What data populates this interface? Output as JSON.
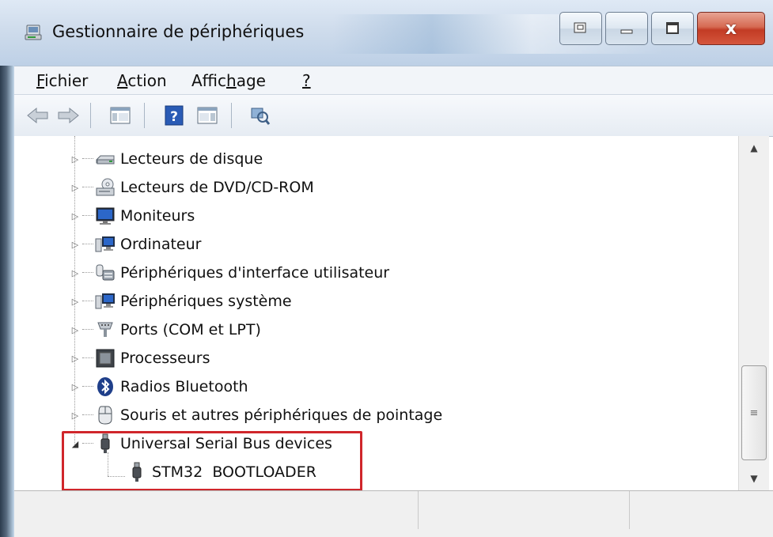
{
  "window": {
    "title": "Gestionnaire de périphériques",
    "buttons": {
      "extra": "",
      "minimize": "",
      "maximize": "",
      "close": "x"
    }
  },
  "menu": [
    {
      "label": "Fichier",
      "mnemonic": "F"
    },
    {
      "label": "Action",
      "mnemonic": "A"
    },
    {
      "label": "Affichage",
      "mnemonic": "h"
    },
    {
      "label": "?",
      "mnemonic": "?"
    }
  ],
  "toolbar": [
    "back-icon",
    "forward-icon",
    "show-hide-console-tree-icon",
    "help-icon",
    "show-action-pane-icon",
    "scan-hardware-icon"
  ],
  "tree": [
    {
      "label": "Lecteurs de disque",
      "icon": "disk-drive-icon",
      "expanded": false
    },
    {
      "label": "Lecteurs de DVD/CD-ROM",
      "icon": "dvd-drive-icon",
      "expanded": false
    },
    {
      "label": "Moniteurs",
      "icon": "monitor-icon",
      "expanded": false
    },
    {
      "label": "Ordinateur",
      "icon": "computer-icon",
      "expanded": false
    },
    {
      "label": "Périphériques d'interface utilisateur",
      "icon": "hid-icon",
      "expanded": false
    },
    {
      "label": "Périphériques système",
      "icon": "system-devices-icon",
      "expanded": false
    },
    {
      "label": "Ports (COM et LPT)",
      "icon": "ports-icon",
      "expanded": false
    },
    {
      "label": "Processeurs",
      "icon": "processor-icon",
      "expanded": false
    },
    {
      "label": "Radios Bluetooth",
      "icon": "bluetooth-icon",
      "expanded": false
    },
    {
      "label": "Souris et autres périphériques de pointage",
      "icon": "mouse-icon",
      "expanded": false
    },
    {
      "label": "Universal Serial Bus devices",
      "icon": "usb-icon",
      "expanded": true,
      "children": [
        {
          "label": "STM32  BOOTLOADER",
          "icon": "usb-device-icon"
        }
      ]
    }
  ],
  "colors": {
    "highlight_box": "#d0262b",
    "title_bg": "#c6d6ea",
    "close_button": "#c23b24"
  }
}
